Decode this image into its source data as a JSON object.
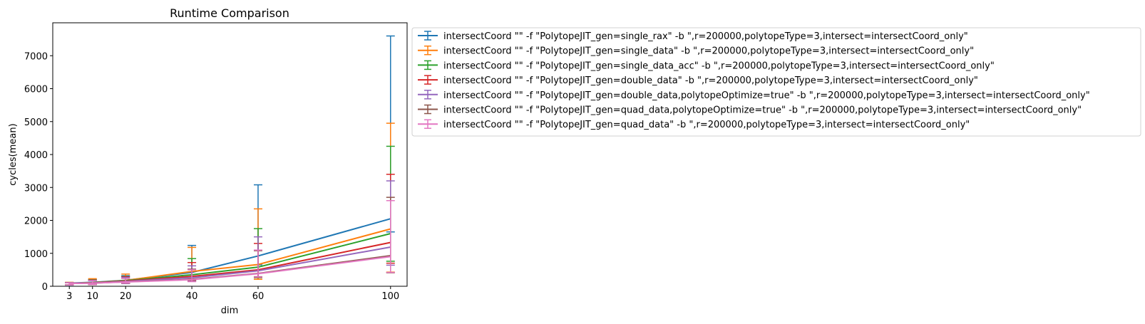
{
  "chart_data": {
    "type": "line",
    "title": "Runtime Comparison",
    "xlabel": "dim",
    "ylabel": "cycles(mean)",
    "x": [
      3,
      10,
      20,
      40,
      60,
      100
    ],
    "x_ticks": [
      "3",
      "10",
      "20",
      "40",
      "60",
      "100"
    ],
    "xlim": [
      -2,
      105
    ],
    "ylim": [
      0,
      8000
    ],
    "y_ticks": [
      "0",
      "1000",
      "2000",
      "3000",
      "4000",
      "5000",
      "6000",
      "7000"
    ],
    "grid": false,
    "legend_placement": "outside upper-right",
    "error_bars": true,
    "series": [
      {
        "name": "intersectCoord \"\" -f \"PolytopeJIT_gen=single_rax\" -b \",r=200000,polytopeType=3,intersect=intersectCoord_only\"",
        "color": "#1f77b4",
        "values": [
          95,
          120,
          180,
          420,
          920,
          2050
        ],
        "err_low": [
          35,
          50,
          80,
          200,
          650,
          1650
        ],
        "err_high": [
          110,
          210,
          320,
          1240,
          3080,
          7600
        ]
      },
      {
        "name": "intersectCoord \"\" -f \"PolytopeJIT_gen=single_data\" -b \",r=200000,polytopeType=3,intersect=intersectCoord_only\"",
        "color": "#ff7f0e",
        "values": [
          90,
          110,
          175,
          450,
          660,
          1740
        ],
        "err_low": [
          40,
          50,
          90,
          220,
          210,
          430
        ],
        "err_high": [
          120,
          230,
          370,
          1180,
          2350,
          4950
        ]
      },
      {
        "name": "intersectCoord \"\" -f \"PolytopeJIT_gen=single_data_acc\" -b \",r=200000,polytopeType=3,intersect=intersectCoord_only\"",
        "color": "#2ca02c",
        "values": [
          90,
          110,
          170,
          350,
          580,
          1600
        ],
        "err_low": [
          40,
          55,
          90,
          190,
          260,
          760
        ],
        "err_high": [
          115,
          200,
          300,
          840,
          1750,
          4250
        ]
      },
      {
        "name": "intersectCoord \"\" -f \"PolytopeJIT_gen=double_data\" -b \",r=200000,polytopeType=3,intersect=intersectCoord_only\"",
        "color": "#d62728",
        "values": [
          88,
          105,
          160,
          300,
          500,
          1330
        ],
        "err_low": [
          40,
          55,
          90,
          170,
          270,
          700
        ],
        "err_high": [
          110,
          190,
          290,
          720,
          1300,
          3400
        ]
      },
      {
        "name": "intersectCoord \"\" -f \"PolytopeJIT_gen=double_data,polytopeOptimize=true\" -b \",r=200000,polytopeType=3,intersect=intersectCoord_only\"",
        "color": "#9467bd",
        "values": [
          88,
          100,
          150,
          260,
          470,
          1190
        ],
        "err_low": [
          40,
          55,
          90,
          160,
          280,
          640
        ],
        "err_high": [
          110,
          180,
          270,
          620,
          1500,
          3200
        ]
      },
      {
        "name": "intersectCoord \"\" -f \"PolytopeJIT_gen=quad_data,polytopeOptimize=true\" -b \",r=200000,polytopeType=3,intersect=intersectCoord_only\"",
        "color": "#8c564b",
        "values": [
          85,
          95,
          135,
          210,
          390,
          930
        ],
        "err_low": [
          40,
          55,
          90,
          150,
          290,
          410
        ],
        "err_high": [
          105,
          170,
          240,
          520,
          1080,
          2700
        ]
      },
      {
        "name": "intersectCoord \"\" -f \"PolytopeJIT_gen=quad_data\" -b \",r=200000,polytopeType=3,intersect=intersectCoord_only\"",
        "color": "#e377c2",
        "values": [
          85,
          95,
          130,
          200,
          380,
          900
        ],
        "err_low": [
          40,
          55,
          90,
          140,
          280,
          420
        ],
        "err_high": [
          105,
          170,
          240,
          500,
          1100,
          2600
        ]
      }
    ]
  }
}
